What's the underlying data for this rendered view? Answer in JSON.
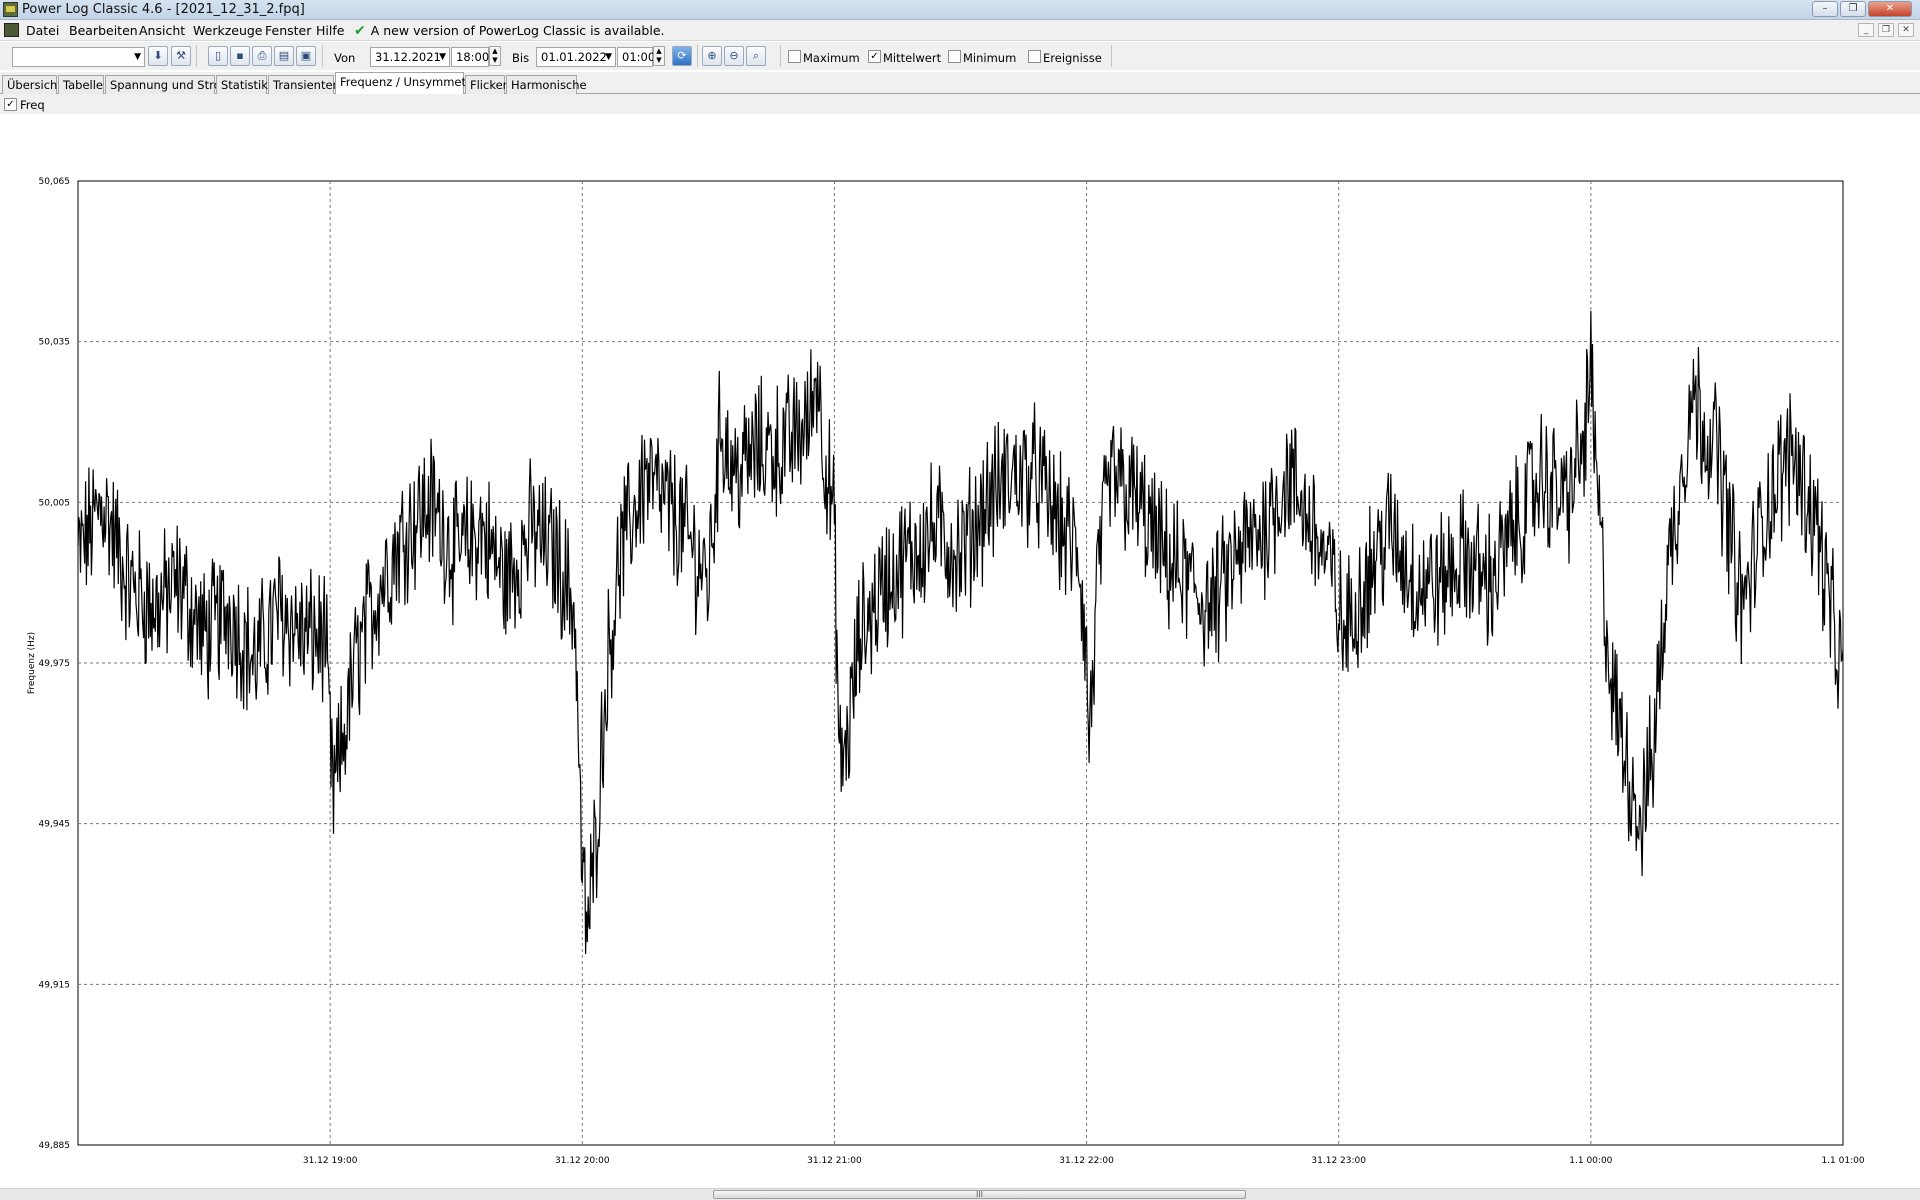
{
  "window": {
    "title": "Power Log Classic 4.6 - [2021_12_31_2.fpq]",
    "buttons": [
      "–",
      "❐",
      "✕"
    ]
  },
  "menu": {
    "items": [
      "Datei",
      "Bearbeiten",
      "Ansicht",
      "Werkzeuge",
      "Fenster",
      "Hilfe"
    ],
    "update_notice": "A new version of PowerLog Classic is available.",
    "mdi_buttons": [
      "_",
      "❐",
      "✕"
    ]
  },
  "toolbar": {
    "channel_select": "",
    "von_label": "Von",
    "von_date": "31.12.2021",
    "von_time": "18:00",
    "bis_label": "Bis",
    "bis_date": "01.01.2022",
    "bis_time": "01:00",
    "checks": [
      {
        "label": "Maximum",
        "checked": false
      },
      {
        "label": "Mittelwert",
        "checked": true
      },
      {
        "label": "Minimum",
        "checked": false
      },
      {
        "label": "Ereignisse",
        "checked": false
      }
    ]
  },
  "tabs": [
    {
      "label": "Übersicht",
      "active": false
    },
    {
      "label": "Tabelle",
      "active": false
    },
    {
      "label": "Spannung und Strom",
      "active": false
    },
    {
      "label": "Statistik",
      "active": false
    },
    {
      "label": "Transienten",
      "active": false
    },
    {
      "label": "Frequenz / Unsymmetrie",
      "active": true
    },
    {
      "label": "Flicker",
      "active": false
    },
    {
      "label": "Harmonische",
      "active": false
    }
  ],
  "filter": {
    "label": "Freq",
    "checked": true
  },
  "scrollbar": {
    "grip": "III"
  },
  "chart_data": {
    "type": "line",
    "ylabel": "Frequenz (Hz)",
    "xlabel": "",
    "title": "",
    "ylim": [
      49.885,
      50.065
    ],
    "y_ticks": [
      "50,065",
      "50,035",
      "50,005",
      "49,975",
      "49,945",
      "49,915",
      "49,885"
    ],
    "x_range_hours": [
      18.0,
      25.0
    ],
    "x_ticks": [
      {
        "h": 19,
        "label": "31.12 19:00"
      },
      {
        "h": 20,
        "label": "31.12 20:00"
      },
      {
        "h": 21,
        "label": "31.12 21:00"
      },
      {
        "h": 22,
        "label": "31.12 22:00"
      },
      {
        "h": 23,
        "label": "31.12 23:00"
      },
      {
        "h": 24,
        "label": "1.1 00:00"
      },
      {
        "h": 25,
        "label": "1.1 01:00"
      }
    ],
    "grid": true,
    "series": [
      {
        "name": "Freq",
        "color": "#000000",
        "x_hours": [
          18.0,
          18.1,
          18.2,
          18.3,
          18.4,
          18.5,
          18.6,
          18.7,
          18.8,
          18.9,
          18.98,
          19.01,
          19.05,
          19.1,
          19.2,
          19.3,
          19.4,
          19.5,
          19.6,
          19.7,
          19.8,
          19.9,
          19.97,
          20.0,
          20.02,
          20.05,
          20.1,
          20.15,
          20.25,
          20.4,
          20.5,
          20.55,
          20.6,
          20.7,
          20.8,
          20.9,
          20.93,
          20.96,
          21.0,
          21.02,
          21.05,
          21.1,
          21.2,
          21.3,
          21.4,
          21.5,
          21.6,
          21.7,
          21.8,
          21.9,
          21.97,
          22.0,
          22.01,
          22.05,
          22.1,
          22.2,
          22.3,
          22.4,
          22.5,
          22.6,
          22.7,
          22.8,
          22.9,
          22.98,
          23.02,
          23.1,
          23.2,
          23.3,
          23.4,
          23.5,
          23.6,
          23.7,
          23.8,
          23.9,
          23.97,
          24.0,
          24.02,
          24.08,
          24.15,
          24.2,
          24.25,
          24.3,
          24.4,
          24.5,
          24.6,
          24.7,
          24.8,
          24.9,
          24.95,
          25.0
        ],
        "values": [
          49.995,
          50.005,
          49.99,
          49.985,
          49.99,
          49.98,
          49.985,
          49.975,
          49.985,
          49.98,
          49.98,
          49.95,
          49.96,
          49.975,
          49.99,
          50.0,
          50.005,
          49.995,
          50.0,
          49.99,
          50.0,
          49.995,
          49.985,
          49.935,
          49.925,
          49.94,
          49.975,
          49.995,
          50.01,
          50.0,
          49.99,
          50.02,
          50.01,
          50.015,
          50.015,
          50.02,
          50.03,
          50.015,
          50.0,
          49.955,
          49.96,
          49.98,
          49.99,
          49.995,
          50.0,
          49.995,
          50.005,
          50.01,
          50.01,
          50.0,
          49.995,
          49.975,
          49.96,
          49.995,
          50.01,
          50.005,
          49.995,
          49.99,
          49.985,
          49.995,
          50.0,
          50.01,
          50.0,
          49.99,
          49.98,
          49.99,
          50.0,
          49.99,
          49.99,
          49.995,
          49.99,
          50.0,
          50.01,
          50.005,
          50.015,
          50.03,
          50.01,
          49.97,
          49.955,
          49.945,
          49.96,
          49.99,
          50.025,
          50.015,
          49.985,
          50.005,
          50.015,
          50.0,
          49.985,
          49.97
        ]
      }
    ]
  }
}
